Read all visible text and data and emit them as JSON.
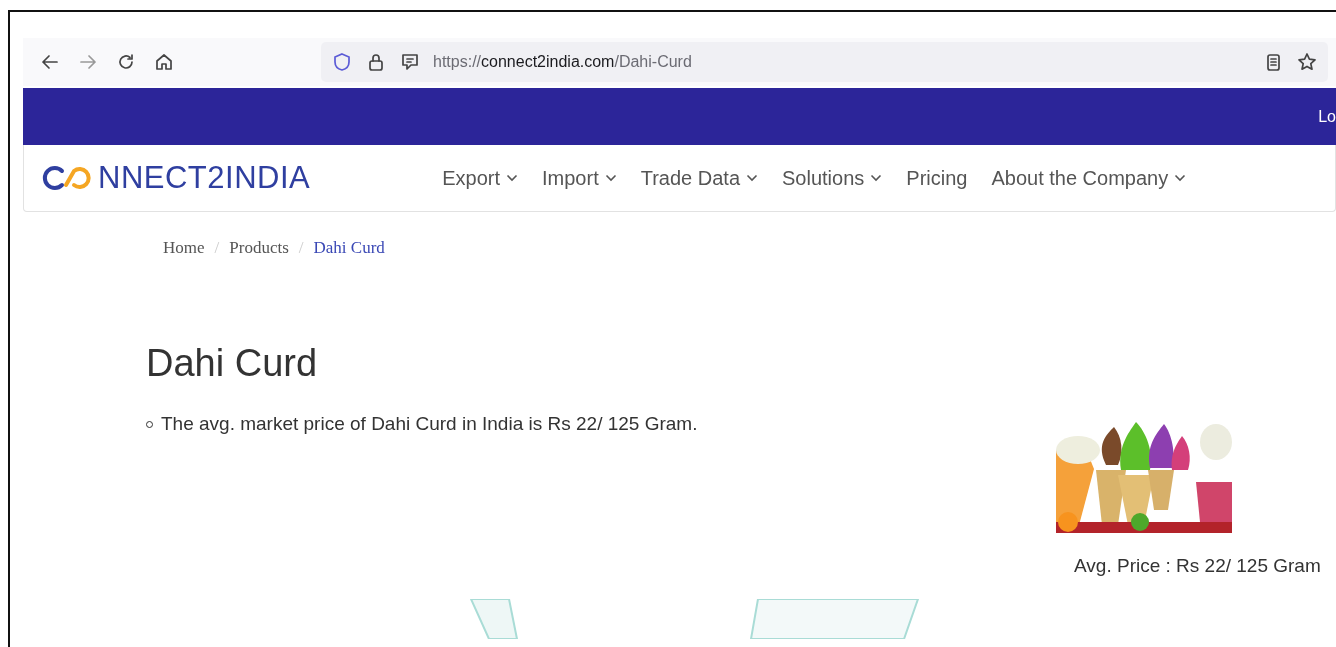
{
  "browser": {
    "url_scheme": "https://",
    "url_host": "connect2india.com",
    "url_path": "/Dahi-Curd"
  },
  "top_bar": {
    "link": "Lo"
  },
  "logo": {
    "text": "NNECT2INDIA"
  },
  "nav": [
    {
      "label": "Export",
      "dropdown": true
    },
    {
      "label": "Import",
      "dropdown": true
    },
    {
      "label": "Trade Data",
      "dropdown": true
    },
    {
      "label": "Solutions",
      "dropdown": true
    },
    {
      "label": "Pricing",
      "dropdown": false
    },
    {
      "label": "About the Company",
      "dropdown": true
    }
  ],
  "breadcrumb": [
    {
      "label": "Home",
      "current": false
    },
    {
      "separator": "/",
      "label": "Products",
      "current": false
    },
    {
      "separator": "/",
      "label": "Dahi Curd",
      "current": true
    }
  ],
  "title": "Dahi Curd",
  "bullets": [
    "The avg. market price of Dahi Curd in India is Rs 22/ 125 Gram."
  ],
  "price_caption": "Avg. Price : Rs 22/ 125 Gram"
}
